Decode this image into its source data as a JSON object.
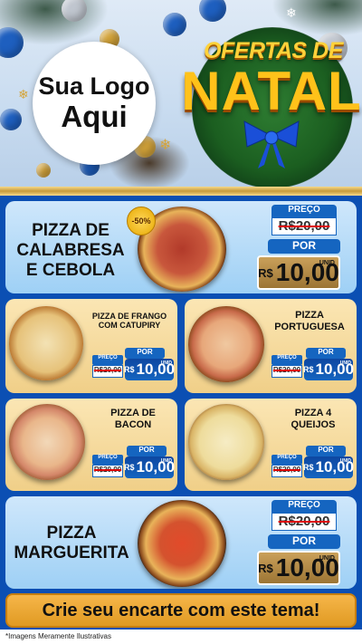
{
  "header": {
    "logo_line1": "Sua Logo",
    "logo_line2": "Aqui",
    "title_top": "OFERTAS DE",
    "title_main": "NATAL"
  },
  "featured": [
    {
      "name": "PIZZA DE CALABRESA E CEBOLA",
      "discount_badge": "-50%",
      "price_label": "PREÇO",
      "old_price": "R$20,00",
      "new_label": "POR",
      "currency": "R$",
      "new_price": "10,00",
      "unit": "UNID"
    },
    {
      "name": "PIZZA MARGUERITA",
      "price_label": "PREÇO",
      "old_price": "R$20,00",
      "new_label": "POR",
      "currency": "R$",
      "new_price": "10,00",
      "unit": "UNID"
    }
  ],
  "grid": [
    {
      "name": "PIZZA DE FRANGO COM CATUPIRY",
      "price_label": "PREÇO",
      "old_price": "R$20,00",
      "new_label": "POR",
      "currency": "R$",
      "new_price": "10,00",
      "unit": "UNID"
    },
    {
      "name": "PIZZA PORTUGUESA",
      "price_label": "PREÇO",
      "old_price": "R$20,00",
      "new_label": "POR",
      "currency": "R$",
      "new_price": "10,00",
      "unit": "UNID"
    },
    {
      "name": "PIZZA DE BACON",
      "price_label": "PREÇO",
      "old_price": "R$20,00",
      "new_label": "POR",
      "currency": "R$",
      "new_price": "10,00",
      "unit": "UNID"
    },
    {
      "name": "PIZZA 4 QUEIJOS",
      "price_label": "PREÇO",
      "old_price": "R$20,00",
      "new_label": "POR",
      "currency": "R$",
      "new_price": "10,00",
      "unit": "UNID"
    }
  ],
  "footer": {
    "cta": "Crie seu encarte com este tema!",
    "disclaimer": "*Imagens Meramente Ilustrativas"
  },
  "colors": {
    "background": "#0b4fb3",
    "price_blue": "#1565c0",
    "title_gold": "#ffc21a",
    "cta_orange": "#f0a830"
  },
  "icons": [
    "christmas-ornament-icon",
    "pine-branch-icon",
    "ribbon-bow-icon",
    "snowflake-icon"
  ]
}
